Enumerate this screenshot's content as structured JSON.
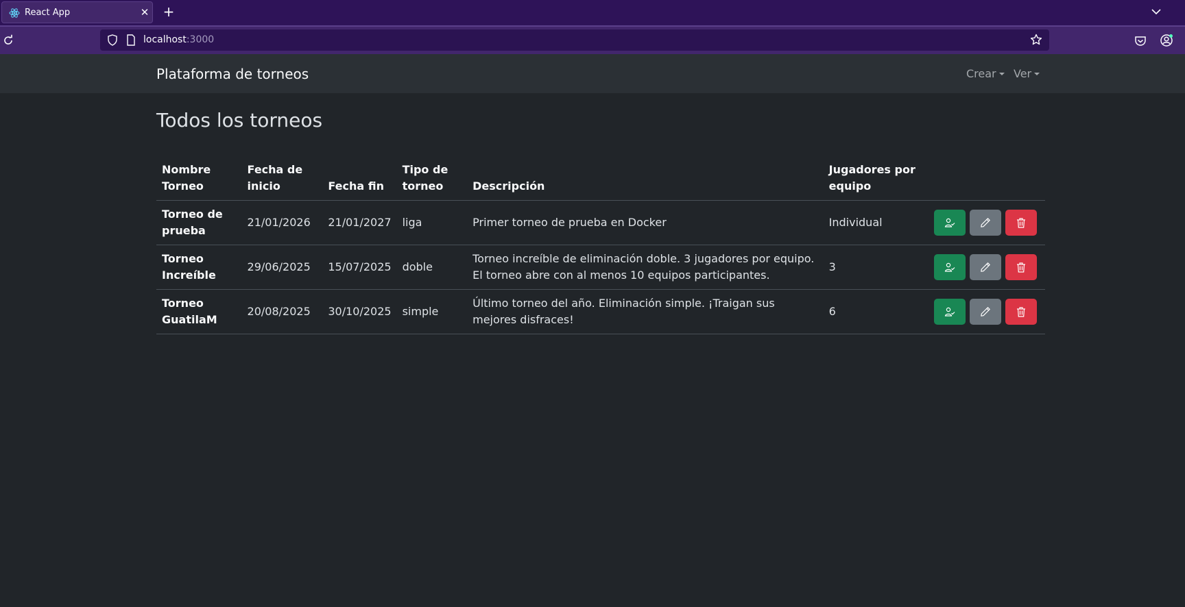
{
  "browser": {
    "tab_title": "React App",
    "tab_close": "✕",
    "new_tab": "+",
    "url_host": "localhost",
    "url_port": ":3000"
  },
  "navbar": {
    "brand": "Plataforma de torneos",
    "items": [
      {
        "label": "Crear"
      },
      {
        "label": "Ver"
      }
    ]
  },
  "page": {
    "title": "Todos los torneos"
  },
  "table": {
    "headers": {
      "name": "Nombre Torneo",
      "start": "Fecha de inicio",
      "end": "Fecha fin",
      "type": "Tipo de torneo",
      "description": "Descripción",
      "players": "Jugadores por equipo"
    },
    "rows": [
      {
        "name": "Torneo de prueba",
        "start": "21/01/2026",
        "end": "21/01/2027",
        "type": "liga",
        "description": "Primer torneo de prueba en Docker",
        "players": "Individual"
      },
      {
        "name": "Torneo Increíble",
        "start": "29/06/2025",
        "end": "15/07/2025",
        "type": "doble",
        "description": "Torneo increíble de eliminación doble. 3 jugadores por equipo. El torneo abre con al menos 10 equipos participantes.",
        "players": "3"
      },
      {
        "name": "Torneo GuatilaM",
        "start": "20/08/2025",
        "end": "30/10/2025",
        "type": "simple",
        "description": "Último torneo del año. Eliminación simple. ¡Traigan sus mejores disfraces!",
        "players": "6"
      }
    ]
  },
  "icons": {
    "register": "person-check-icon",
    "edit": "pencil-icon",
    "delete": "trash-icon"
  },
  "colors": {
    "success": "#198754",
    "secondary": "#6c757d",
    "danger": "#dc3545",
    "browser_tabbar": "#2e1358"
  }
}
